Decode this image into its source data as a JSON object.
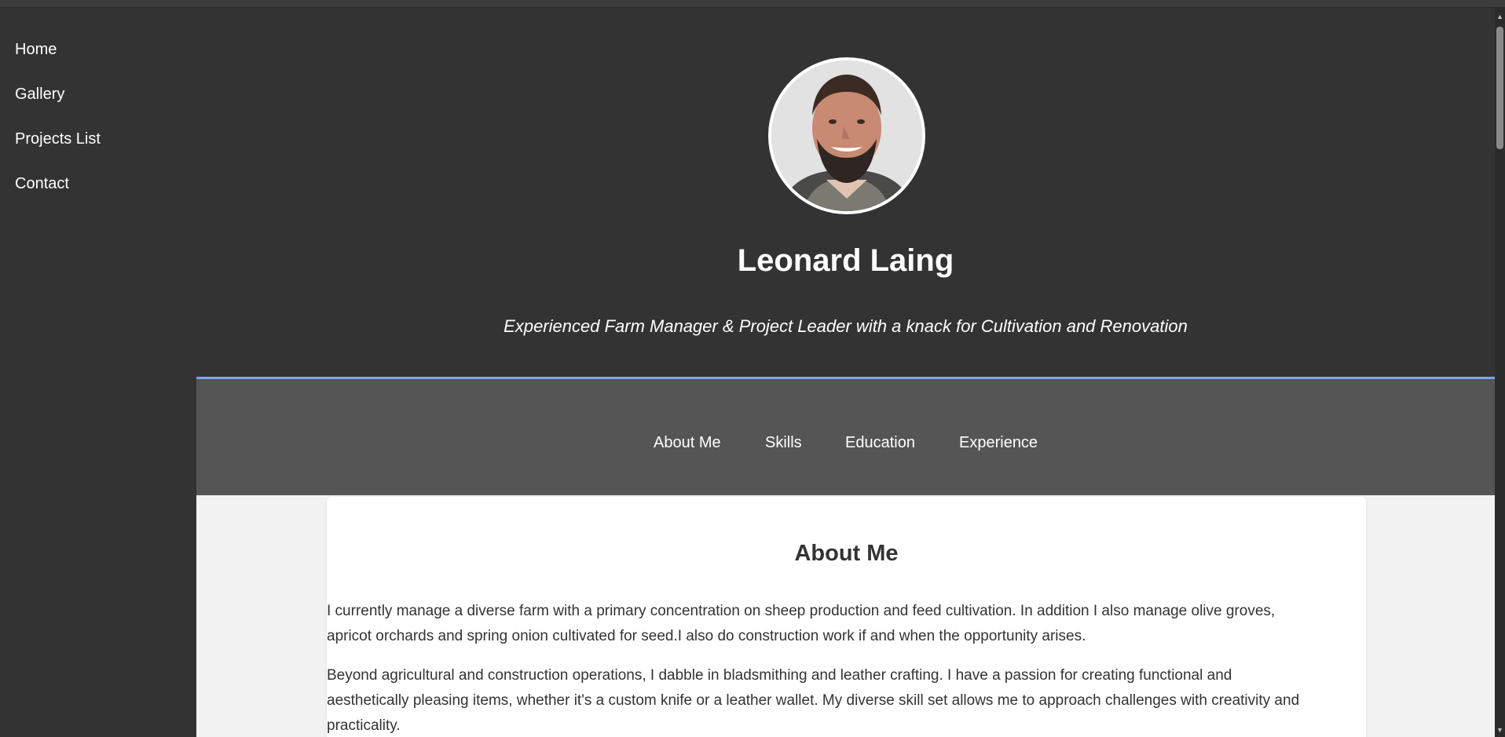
{
  "sidebar": {
    "items": [
      {
        "label": "Home"
      },
      {
        "label": "Gallery"
      },
      {
        "label": "Projects List"
      },
      {
        "label": "Contact"
      }
    ]
  },
  "profile": {
    "name": "Leonard Laing",
    "tagline": "Experienced Farm Manager & Project Leader with a knack for Cultivation and Renovation",
    "avatar_icon": "portrait-photo"
  },
  "tabs": [
    {
      "label": "About Me"
    },
    {
      "label": "Skills"
    },
    {
      "label": "Education"
    },
    {
      "label": "Experience"
    }
  ],
  "about": {
    "title": "About Me",
    "paragraphs": [
      {
        "lines": [
          "I currently manage a diverse farm with a primary concentration on sheep production and feed cultivation. In addition I also manage olive groves,",
          "apricot orchards and spring onion cultivated for seed.I also do construction work if and when the opportunity arises."
        ]
      },
      {
        "lines": [
          "Beyond agricultural and construction operations, I dabble in bladsmithing and leather crafting. I have a passion for creating functional and",
          "aesthetically pleasing items, whether it's a custom knife or a leather wallet. My diverse skill set allows me to approach challenges with creativity and",
          "practicality."
        ]
      }
    ]
  },
  "colors": {
    "page_bg": "#333333",
    "tabbar_bg": "#555555",
    "accent_rule": "#7ea6e8",
    "content_bg": "#f2f2f2"
  }
}
